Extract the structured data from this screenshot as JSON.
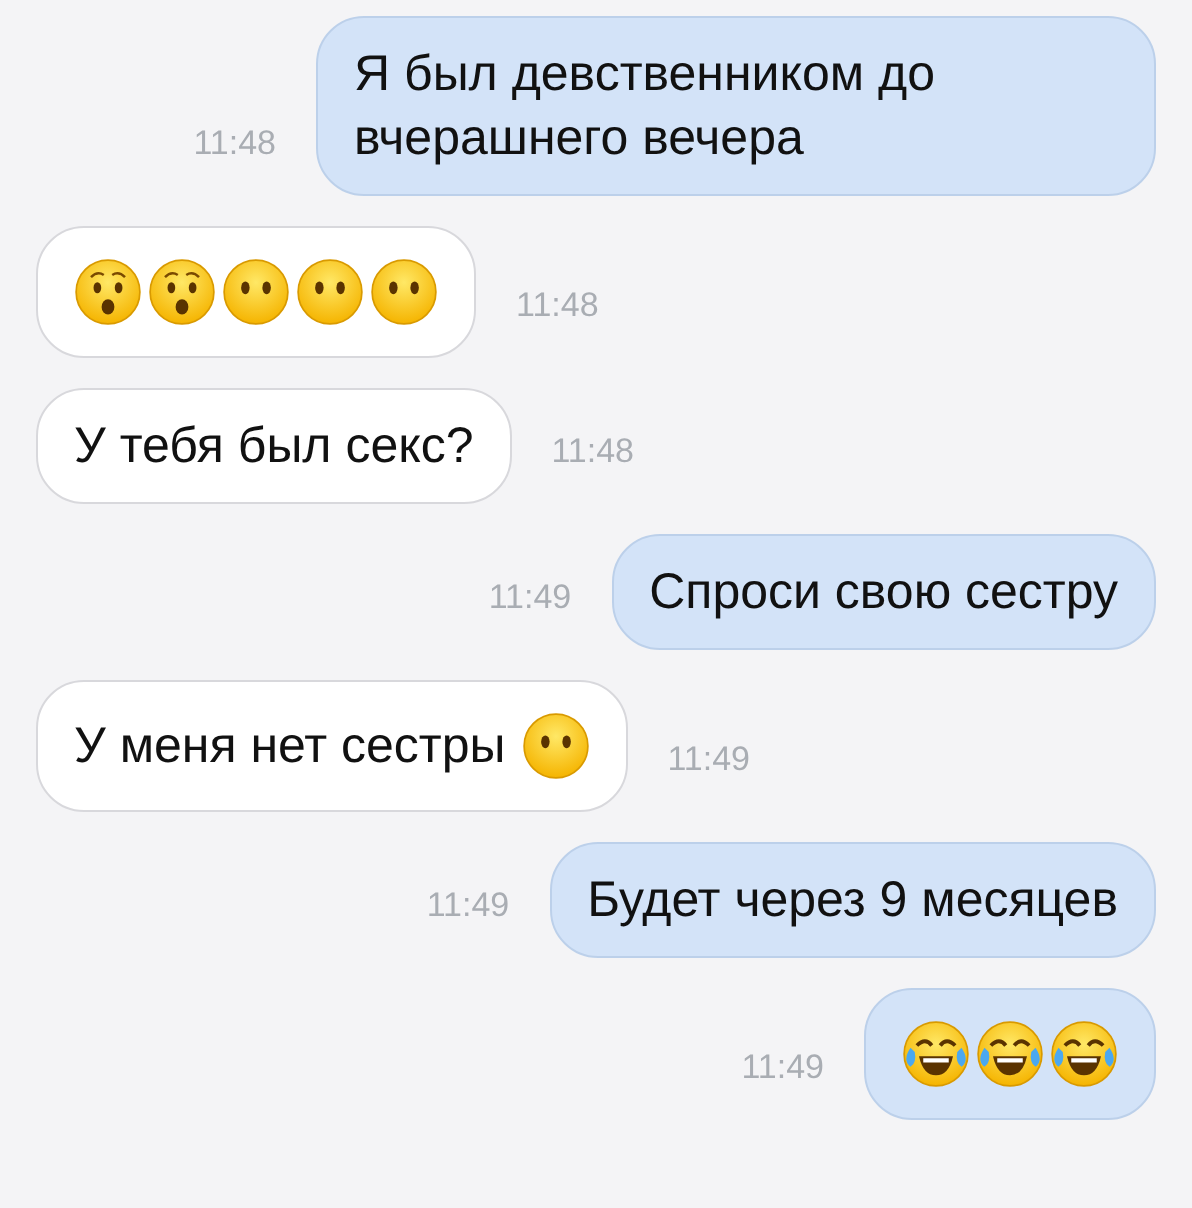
{
  "messages": [
    {
      "kind": "sent",
      "time": "11:48",
      "text": "Я был девственником до вчерашнего вечера"
    },
    {
      "kind": "received",
      "time": "11:48",
      "emoji": [
        {
          "kind": "hushed"
        },
        {
          "kind": "hushed"
        },
        {
          "kind": "no-mouth"
        },
        {
          "kind": "no-mouth"
        },
        {
          "kind": "no-mouth"
        }
      ]
    },
    {
      "kind": "received",
      "time": "11:48",
      "text": "У тебя был секс?"
    },
    {
      "kind": "sent",
      "time": "11:49",
      "text": "Спроси свою сестру"
    },
    {
      "kind": "received",
      "time": "11:49",
      "text": "У меня нет сестры",
      "emoji": [
        {
          "kind": "no-mouth"
        }
      ]
    },
    {
      "kind": "sent",
      "time": "11:49",
      "text": "Будет через 9 месяцев"
    },
    {
      "kind": "sent",
      "time": "11:49",
      "emoji": [
        {
          "kind": "tears-of-joy"
        },
        {
          "kind": "tears-of-joy"
        },
        {
          "kind": "tears-of-joy"
        }
      ]
    }
  ]
}
